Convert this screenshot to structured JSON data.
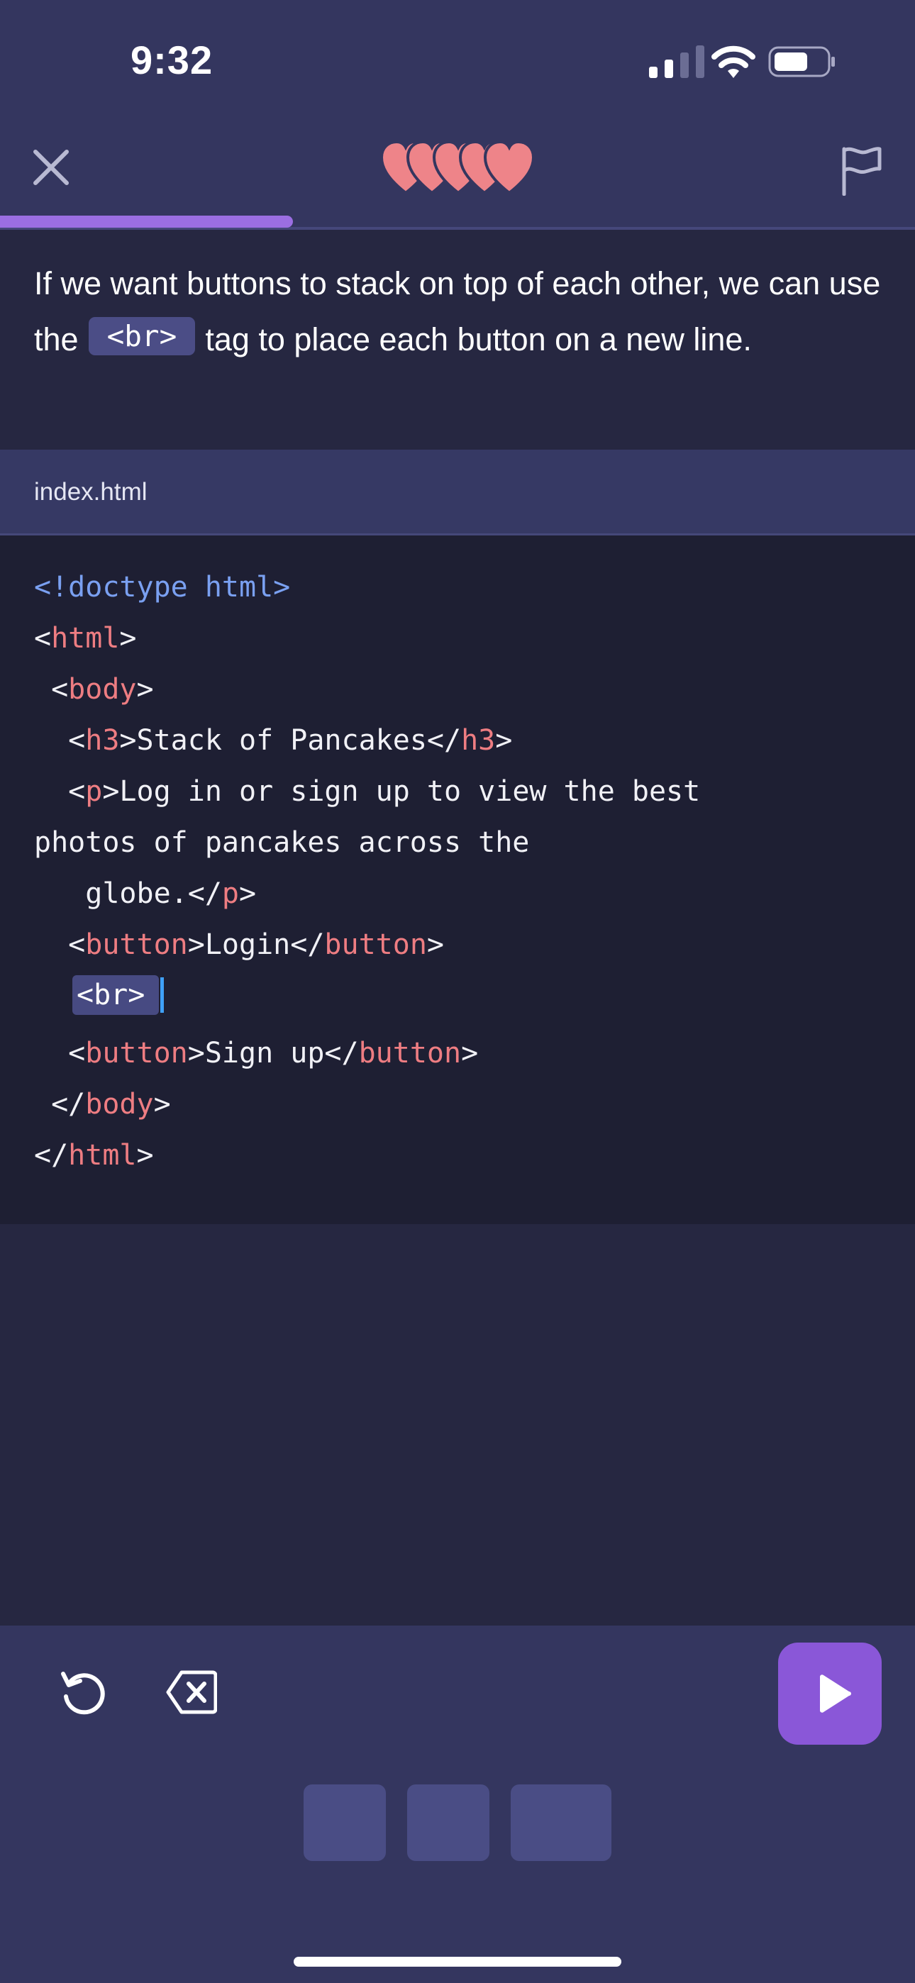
{
  "status_bar": {
    "time": "9:32",
    "icons": [
      "cellular-signal-icon",
      "wifi-icon",
      "battery-icon"
    ]
  },
  "header": {
    "close_icon": "close-icon",
    "lives": 5,
    "lives_icon": "heart-icon",
    "report_icon": "flag-icon",
    "progress": 0.32
  },
  "instruction": {
    "before": "If we want buttons to stack on top of each other, we can use the",
    "code": "<br>",
    "after": "tag to place each button on a new line."
  },
  "editor": {
    "file_name": "index.html",
    "lines": {
      "l1": "<!doctype html>",
      "l2_open": "<",
      "l2_tag": "html",
      "l2_close": ">",
      "l3_open": " <",
      "l3_tag": "body",
      "l3_close": ">",
      "l4_a": "  <",
      "l4_tag1": "h3",
      "l4_b": ">Stack of Pancakes</",
      "l4_tag2": "h3",
      "l4_c": ">",
      "l5_a": "  <",
      "l5_tag": "p",
      "l5_b": ">Log in or sign up to view the best",
      "l6": "photos of pancakes across the",
      "l7_a": "   globe.</",
      "l7_tag": "p",
      "l7_b": ">",
      "l8_a": "  <",
      "l8_tag1": "button",
      "l8_b": ">Login</",
      "l8_tag2": "button",
      "l8_c": ">",
      "l9_token": "<br>",
      "l10_a": "  <",
      "l10_tag1": "button",
      "l10_b": ">Sign up</",
      "l10_tag2": "button",
      "l10_c": ">",
      "l11_a": " </",
      "l11_tag": "body",
      "l11_b": ">",
      "l12_a": "</",
      "l12_tag": "html",
      "l12_b": ">"
    }
  },
  "toolbar": {
    "undo_icon": "undo-icon",
    "delete_icon": "backspace-icon",
    "run_icon": "play-icon",
    "answer_slots": 3
  },
  "colors": {
    "accent": "#8a57d8",
    "progress": "#9b6ee2",
    "heart": "#ee8489",
    "tag": "#ee7d82",
    "doctype": "#7aa0f1",
    "cursor": "#3fa0f7"
  }
}
